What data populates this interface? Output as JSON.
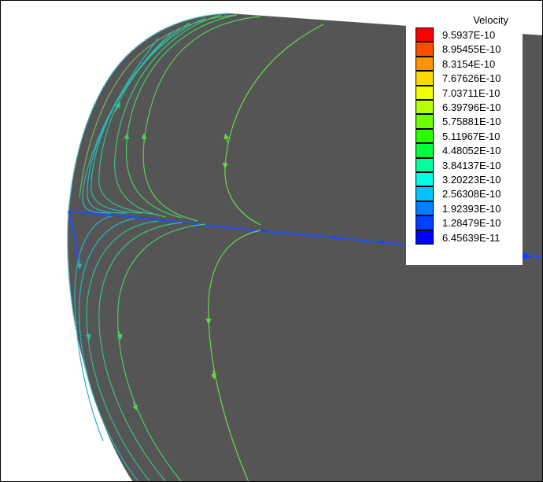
{
  "legend": {
    "title": "Velocity",
    "entries": [
      {
        "label": "9.5937E-10",
        "color": "#ff0000"
      },
      {
        "label": "8.95455E-10",
        "color": "#ff4c00"
      },
      {
        "label": "8.3154E-10",
        "color": "#ff9400"
      },
      {
        "label": "7.67626E-10",
        "color": "#ffd800"
      },
      {
        "label": "7.03711E-10",
        "color": "#f0ff00"
      },
      {
        "label": "6.39796E-10",
        "color": "#b4ff00"
      },
      {
        "label": "5.75881E-10",
        "color": "#6cff00"
      },
      {
        "label": "5.11967E-10",
        "color": "#28ff00"
      },
      {
        "label": "4.48052E-10",
        "color": "#00ff3c"
      },
      {
        "label": "3.84137E-10",
        "color": "#00ff9c"
      },
      {
        "label": "3.20223E-10",
        "color": "#00ffe4"
      },
      {
        "label": "2.56308E-10",
        "color": "#00c4ff"
      },
      {
        "label": "1.92393E-10",
        "color": "#0080ff"
      },
      {
        "label": "1.28479E-10",
        "color": "#0040ff"
      },
      {
        "label": "6.45639E-11",
        "color": "#0000ff"
      }
    ]
  },
  "colors": {
    "surface": "#555555",
    "background": "#ffffff",
    "attachment_line": "#1f4cff"
  }
}
